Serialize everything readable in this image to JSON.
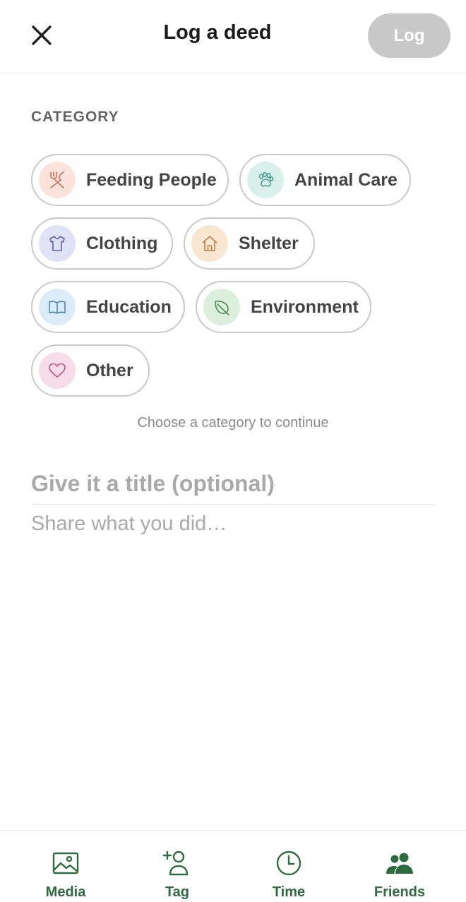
{
  "header": {
    "title": "Log a deed",
    "log_label": "Log",
    "close_icon": "close-icon"
  },
  "category": {
    "label": "CATEGORY",
    "items": [
      {
        "label": "Feeding People",
        "icon": "fork-knife-icon",
        "bg": "#fbe3dc",
        "stroke": "#c9705c"
      },
      {
        "label": "Animal Care",
        "icon": "paw-icon",
        "bg": "#d9efec",
        "stroke": "#4a9a92"
      },
      {
        "label": "Clothing",
        "icon": "shirt-icon",
        "bg": "#dfe1f5",
        "stroke": "#5b62a8"
      },
      {
        "label": "Shelter",
        "icon": "house-icon",
        "bg": "#f8e6d0",
        "stroke": "#b98348"
      },
      {
        "label": "Education",
        "icon": "book-icon",
        "bg": "#dbebf7",
        "stroke": "#4e86b2"
      },
      {
        "label": "Environment",
        "icon": "leaf-icon",
        "bg": "#dcefdc",
        "stroke": "#4d8a52"
      },
      {
        "label": "Other",
        "icon": "heart-icon",
        "bg": "#f6dbe8",
        "stroke": "#b8567f"
      }
    ],
    "hint": "Choose a category to continue"
  },
  "form": {
    "title_placeholder": "Give it a title (optional)",
    "body_placeholder": "Share what you did…"
  },
  "bottom_bar": {
    "items": [
      {
        "label": "Media",
        "icon": "image-icon"
      },
      {
        "label": "Tag",
        "icon": "add-person-icon"
      },
      {
        "label": "Time",
        "icon": "clock-icon"
      },
      {
        "label": "Friends",
        "icon": "people-icon"
      }
    ],
    "accent": "#2f6b3f"
  },
  "colors": {
    "log_button_disabled": "#c8c8c8",
    "chip_border": "#c9c9c9"
  }
}
